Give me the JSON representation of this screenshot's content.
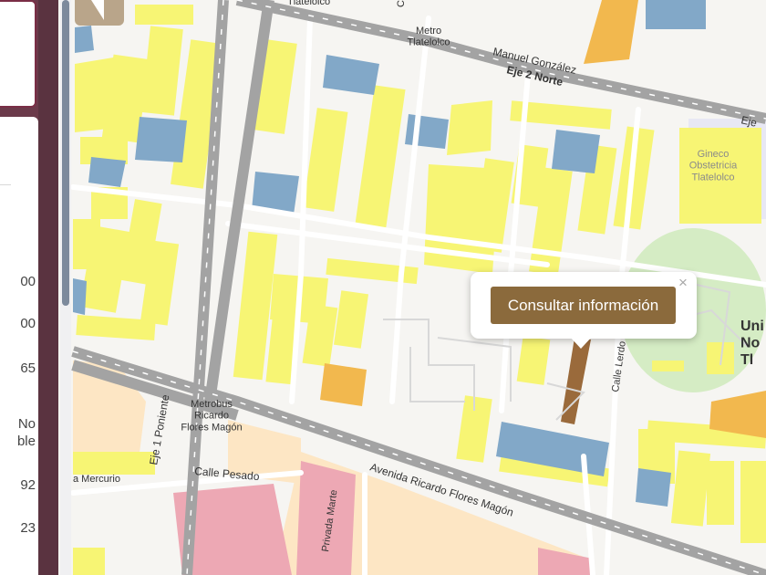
{
  "map": {
    "colors": {
      "background": "#f6f5f2",
      "road_major": "#a3a3a3",
      "road_minor": "#ffffff",
      "building_residential": "#f7f574",
      "building_public": "#82a8c8",
      "building_commercial": "#f2b84e",
      "area_institutional": "#e7d3a7",
      "area_commercial": "#e9a6b2",
      "park": "#d5ecc4",
      "selected_parcel": "#9a6a3b"
    },
    "labels": {
      "metro_tlatelolco": "Metro\nTlatelolco",
      "manuel_gonzalez": "Manuel González",
      "eje2_norte": "Eje 2 Norte",
      "eje_right": "Eje",
      "gineco": "Gineco\nObstetricia\nTlatelolco",
      "metrobus": "Metrobus\nRicardo\nFlores Magón",
      "eje1_poniente": "Eje 1 Poniente",
      "calle_pesado": "Calle Pesado",
      "mercurio": "a Mercurio",
      "avenida_flores_magon": "Avenida Ricardo Flores Magón",
      "privada_marte": "Privada Marte",
      "calle_lerdo": "Calle Lerdo",
      "uni": "Uni\nNo\nTl",
      "top_street": "Tlatelolco",
      "top_c": "C"
    }
  },
  "sidebar": {
    "values": [
      "00",
      "00",
      "65",
      "No\nble",
      "92",
      "23"
    ]
  },
  "popup": {
    "button_label": "Consultar información",
    "close_symbol": "×"
  }
}
